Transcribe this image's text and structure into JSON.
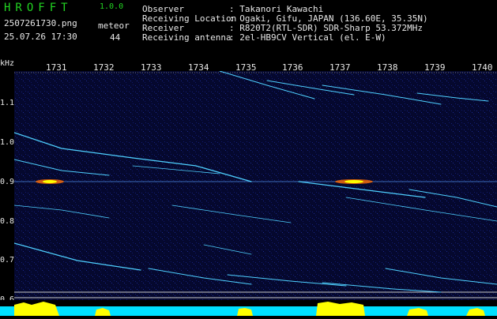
{
  "header": {
    "app_name": "HROFFT",
    "version": "1.0.0",
    "filename": "2507261730.png",
    "datetime": "25.07.26 17:30",
    "meteor_label": "meteor",
    "meteor_count": "44",
    "info": [
      {
        "label": "Observer",
        "value": ": Takanori Kawachi"
      },
      {
        "label": "Receiving Location",
        "value": ": Ogaki, Gifu, JAPAN (136.60E, 35.35N)"
      },
      {
        "label": "Receiver",
        "value": ": R820T2(RTL-SDR) SDR-Sharp 53.372MHz"
      },
      {
        "label": "Receiving antenna",
        "value": ": 2el-HB9CV Vertical (el. E-W)"
      }
    ]
  },
  "axes": {
    "y_unit": "kHz",
    "time_ticks": [
      "1731",
      "1732",
      "1733",
      "1734",
      "1735",
      "1736",
      "1737",
      "1738",
      "1739",
      "1740"
    ],
    "freq_ticks": [
      "1.1",
      "1.0",
      "0.9",
      "0.8",
      "0.7",
      "0.6"
    ]
  },
  "colors": {
    "app_green": "#22d322",
    "text": "#e8e8e8",
    "plot_bg": "#05082e",
    "trace": "#4fd0ff",
    "peak": "#ffff00",
    "noise_floor": "#00e0ff"
  }
}
